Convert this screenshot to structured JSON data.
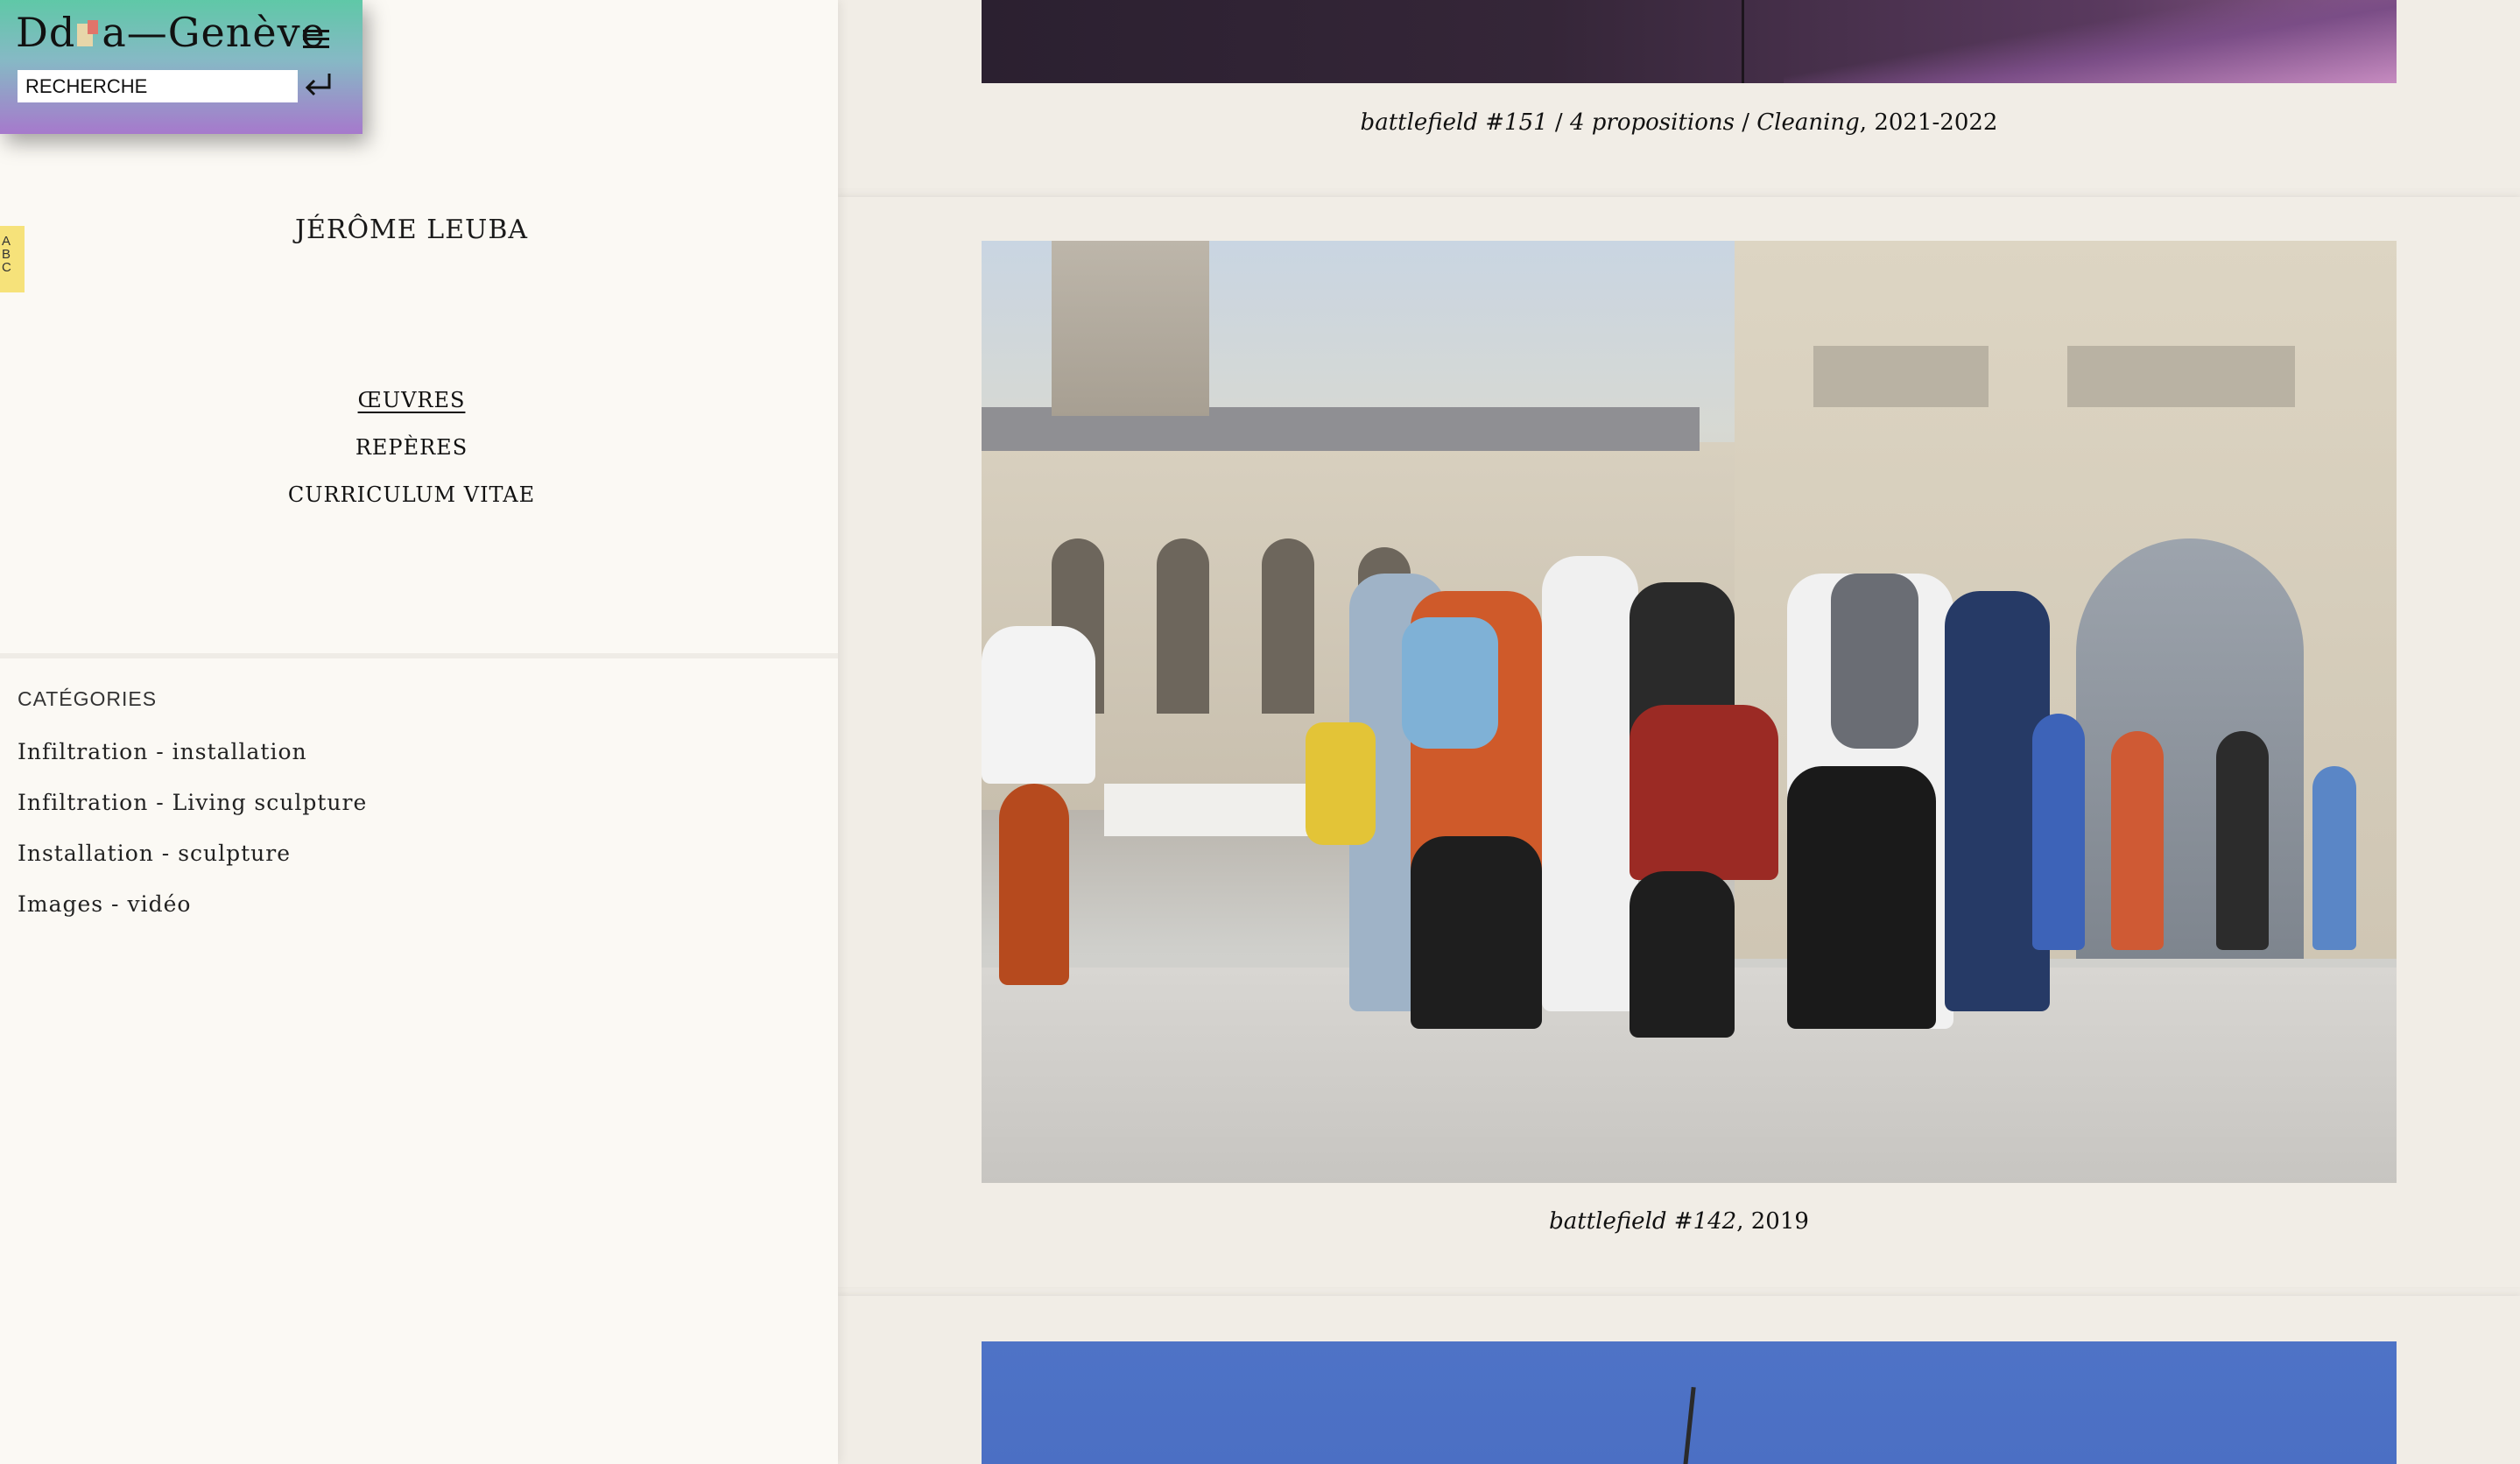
{
  "header": {
    "logo_text": "Dd",
    "logo_text_after": "a—Genève",
    "search_placeholder": "RECHERCHE",
    "abc_letters": [
      "A",
      "B",
      "C"
    ]
  },
  "artist": {
    "name": "JÉRÔME LEUBA"
  },
  "nav": {
    "items": [
      "ŒUVRES",
      "REPÈRES",
      "CURRICULUM VITAE"
    ],
    "active_index": 0
  },
  "categories": {
    "heading": "CATÉGORIES",
    "items": [
      "Infiltration - installation",
      "Infiltration - Living sculpture",
      "Installation - sculpture",
      "Images - vidéo"
    ]
  },
  "works": [
    {
      "title_parts": [
        "battlefield #151",
        " / ",
        "4 propositions",
        " / ",
        "Cleaning"
      ],
      "year": ", 2021-2022"
    },
    {
      "title": "battlefield #142",
      "year": ", 2019"
    }
  ],
  "colors": {
    "sidebar_bg": "#fbf9f4",
    "content_bg": "#efebe4",
    "logo_gradient_top": "#5fc8a7",
    "logo_gradient_bottom": "#a679cc",
    "abc_tab": "#f6e27a"
  },
  "icons": {
    "menu": "hamburger-icon",
    "search_submit": "enter-arrow-icon"
  }
}
